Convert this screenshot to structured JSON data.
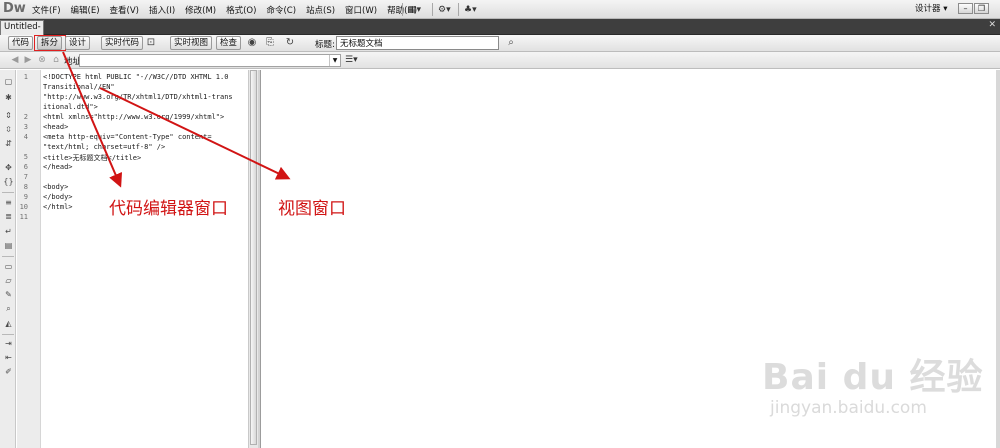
{
  "app": {
    "logo": "Dw"
  },
  "menu": {
    "items": [
      "文件(F)",
      "编辑(E)",
      "查看(V)",
      "插入(I)",
      "修改(M)",
      "格式(O)",
      "命令(C)",
      "站点(S)",
      "窗口(W)",
      "帮助(H)"
    ],
    "workspace": "设计器"
  },
  "tabs": [
    {
      "label": "Untitled-2"
    }
  ],
  "toolbar": {
    "code": "代码",
    "split": "拆分",
    "design": "设计",
    "live_code": "实时代码",
    "live_view": "实时视图",
    "inspect": "检查",
    "title_label": "标题:",
    "title_value": "无标题文档"
  },
  "address": {
    "label": "地址"
  },
  "editor": {
    "line_numbers": [
      "1",
      "2",
      "3",
      "4",
      "5",
      "6",
      "7",
      "8",
      "9",
      "10",
      "11"
    ],
    "lines": [
      "<!DOCTYPE html PUBLIC \"-//W3C//DTD XHTML 1.0",
      "Transitional//EN\"",
      "\"http://www.w3.org/TR/xhtml1/DTD/xhtml1-trans",
      "itional.dtd\">",
      "<html xmlns=\"http://www.w3.org/1999/xhtml\">",
      "<head>",
      "<meta http-equiv=\"Content-Type\" content=",
      "\"text/html; charset=utf-8\" />",
      "<title>无标题文档</title>",
      "</head>",
      "",
      "<body>",
      "</body>",
      "</html>",
      ""
    ]
  },
  "annotations": {
    "code_editor": "代码编辑器窗口",
    "view_window": "视图窗口",
    "color": "#d11414"
  },
  "watermark": {
    "logo": "Bai du 经验",
    "url": "jingyan.baidu.com"
  }
}
